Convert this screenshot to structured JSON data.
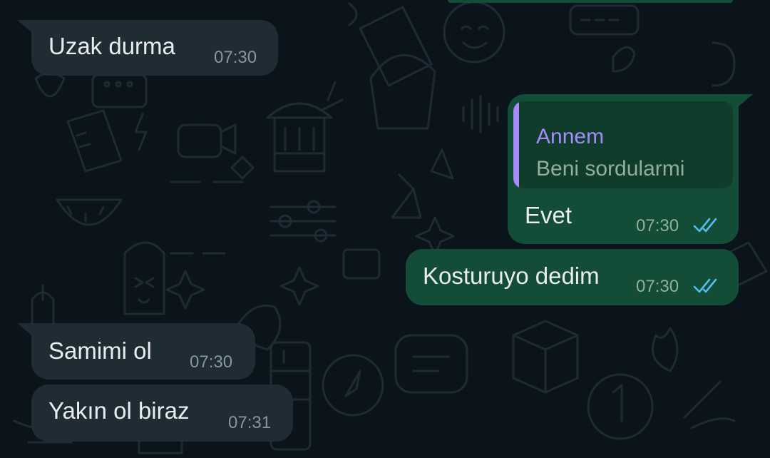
{
  "messages": [
    {
      "direction": "incoming",
      "text": "Uzak durma",
      "time": "07:30"
    },
    {
      "direction": "outgoing",
      "quote": {
        "author": "Annem",
        "text": "Beni sordularmi"
      },
      "text": "Evet",
      "time": "07:30",
      "status": "read"
    },
    {
      "direction": "outgoing",
      "text": "Kosturuyo dedim",
      "time": "07:30",
      "status": "read"
    },
    {
      "direction": "incoming",
      "text": "Samimi ol",
      "time": "07:30"
    },
    {
      "direction": "incoming",
      "text": "Yakın ol biraz",
      "time": "07:31"
    }
  ],
  "colors": {
    "background": "#0b141a",
    "incoming_bubble": "#202c33",
    "outgoing_bubble": "#144d37",
    "quote_accent": "#a78bfa",
    "read_ticks": "#53bdeb"
  },
  "icons": {
    "read_status": "double-check-icon",
    "wallpaper": "doodle-pattern"
  }
}
